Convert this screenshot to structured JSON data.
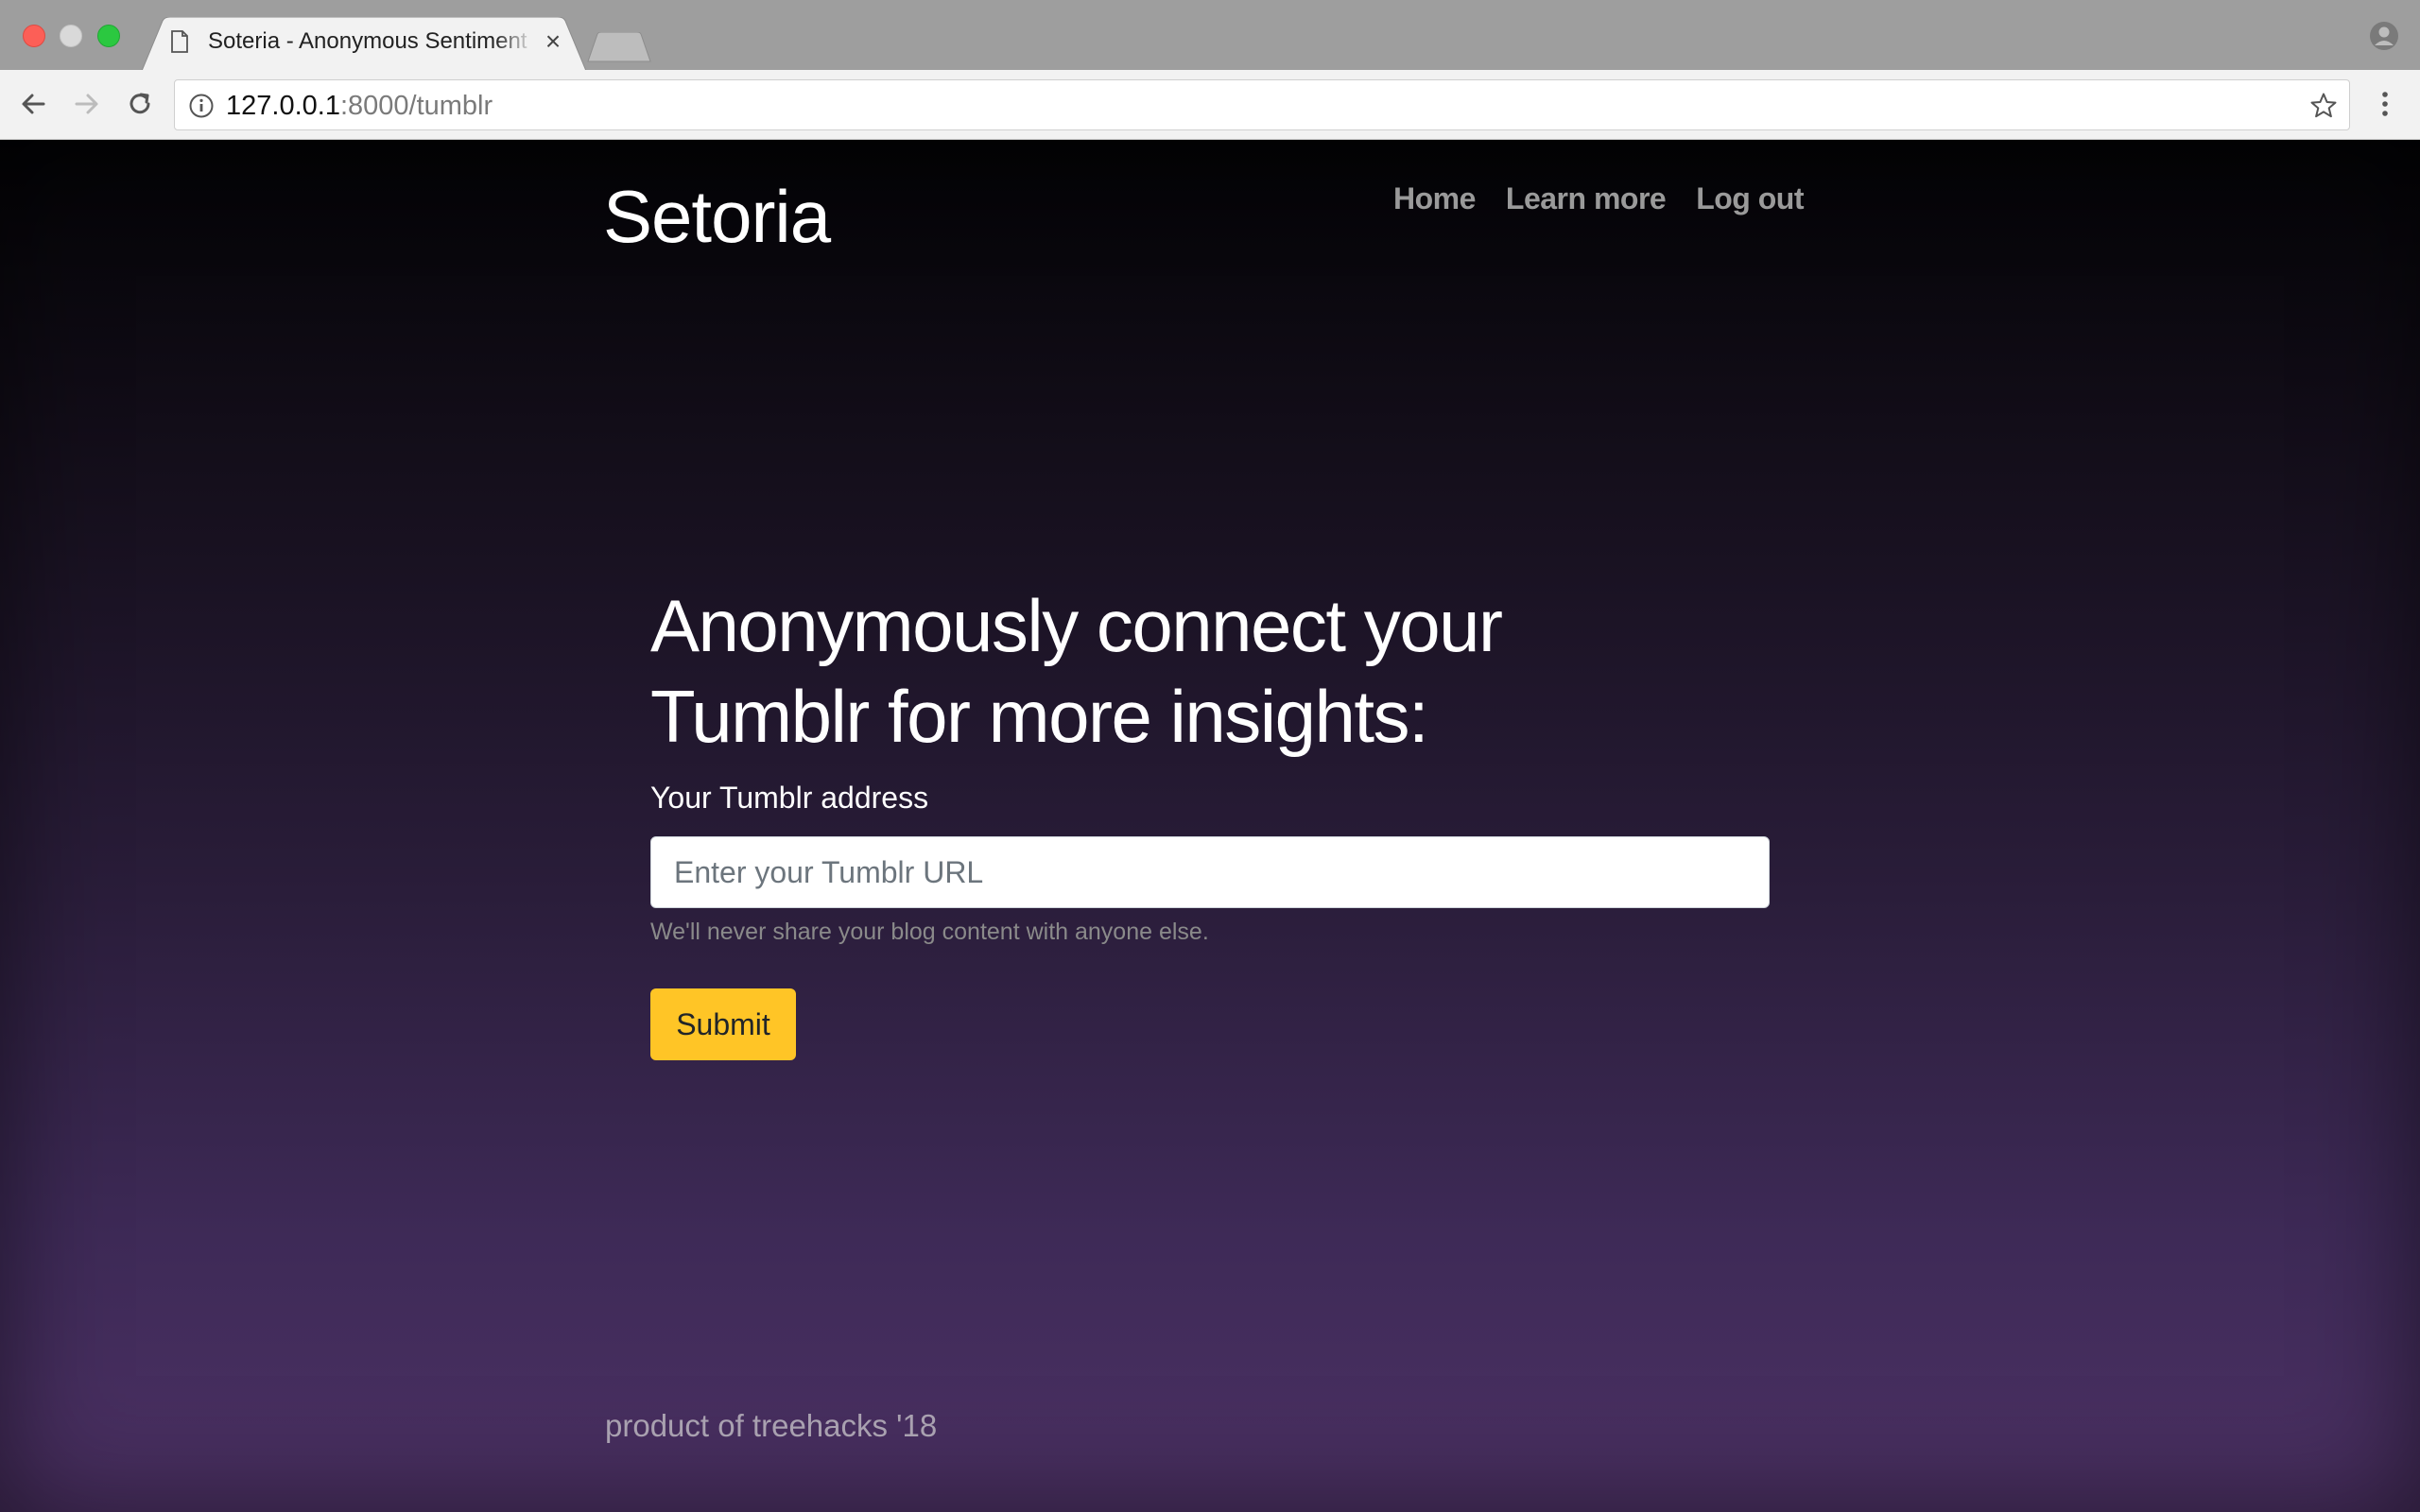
{
  "browser": {
    "tab_title": "Soteria - Anonymous Sentiment",
    "tab_close": "×",
    "url_host": "127.0.0.1",
    "url_path": ":8000/tumblr"
  },
  "site": {
    "brand": "Setoria",
    "nav": {
      "home": "Home",
      "learn_more": "Learn more",
      "log_out": "Log out"
    }
  },
  "form": {
    "headline_line1": "Anonymously connect your",
    "headline_line2": "Tumblr for more insights:",
    "label": "Your Tumblr address",
    "input_placeholder": "Enter your Tumblr URL",
    "input_value": "",
    "help": "We'll never share your blog content with anyone else.",
    "submit_label": "Submit"
  },
  "footer": {
    "text": "product of treehacks '18"
  },
  "colors": {
    "accent_button": "#ffc526",
    "background_top": "#030305",
    "background_bottom": "#4c3164",
    "nav_link": "#9a9a9a"
  },
  "icons": {
    "tab": "document-icon",
    "toolbar": [
      "back-arrow-icon",
      "forward-arrow-icon",
      "reload-icon",
      "info-icon",
      "star-icon",
      "menu-dots-icon",
      "profile-icon"
    ]
  }
}
